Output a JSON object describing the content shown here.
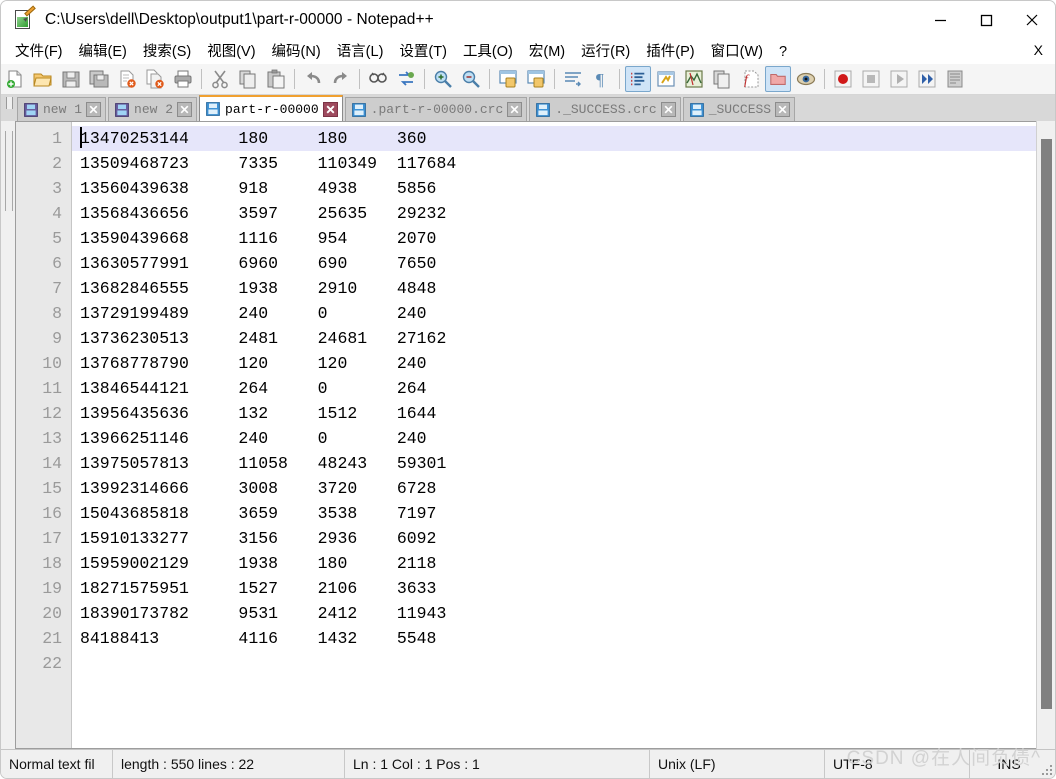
{
  "window": {
    "title": "C:\\Users\\dell\\Desktop\\output1\\part-r-00000 - Notepad++",
    "app_icon": "notepad-plus-plus-icon",
    "minimize_label": "—",
    "maximize_label": "□",
    "close_label": "✕"
  },
  "menu": {
    "items": [
      {
        "text": "文件(F)",
        "key": "F"
      },
      {
        "text": "编辑(E)",
        "key": "E"
      },
      {
        "text": "搜索(S)",
        "key": "S"
      },
      {
        "text": "视图(V)",
        "key": "V"
      },
      {
        "text": "编码(N)",
        "key": "N"
      },
      {
        "text": "语言(L)",
        "key": "L"
      },
      {
        "text": "设置(T)",
        "key": "T"
      },
      {
        "text": "工具(O)",
        "key": "O"
      },
      {
        "text": "宏(M)",
        "key": "M"
      },
      {
        "text": "运行(R)",
        "key": "R"
      },
      {
        "text": "插件(P)",
        "key": "P"
      },
      {
        "text": "窗口(W)",
        "key": "W"
      },
      {
        "text": "?",
        "key": ""
      }
    ],
    "close_document_label": "X"
  },
  "toolbar": {
    "buttons": [
      {
        "name": "new-file-icon",
        "active": false
      },
      {
        "name": "open-file-icon",
        "active": false
      },
      {
        "name": "save-icon",
        "active": false
      },
      {
        "name": "save-all-icon",
        "active": false
      },
      {
        "name": "close-file-icon",
        "active": false
      },
      {
        "name": "close-all-files-icon",
        "active": false
      },
      {
        "name": "print-icon",
        "active": false
      },
      {
        "name": "separator",
        "active": false
      },
      {
        "name": "cut-icon",
        "active": false
      },
      {
        "name": "copy-icon",
        "active": false
      },
      {
        "name": "paste-icon",
        "active": false
      },
      {
        "name": "separator",
        "active": false
      },
      {
        "name": "undo-icon",
        "active": false
      },
      {
        "name": "redo-icon",
        "active": false
      },
      {
        "name": "separator",
        "active": false
      },
      {
        "name": "find-icon",
        "active": false
      },
      {
        "name": "replace-icon",
        "active": false
      },
      {
        "name": "separator",
        "active": false
      },
      {
        "name": "zoom-in-icon",
        "active": false
      },
      {
        "name": "zoom-out-icon",
        "active": false
      },
      {
        "name": "separator",
        "active": false
      },
      {
        "name": "sync-vertical-scroll-icon",
        "active": false
      },
      {
        "name": "sync-horizontal-scroll-icon",
        "active": false
      },
      {
        "name": "separator",
        "active": false
      },
      {
        "name": "word-wrap-icon",
        "active": false
      },
      {
        "name": "show-all-characters-icon",
        "active": false
      },
      {
        "name": "separator",
        "active": false
      },
      {
        "name": "indent-guide-icon",
        "active": true
      },
      {
        "name": "user-defined-language-icon",
        "active": false
      },
      {
        "name": "document-map-icon",
        "active": false
      },
      {
        "name": "document-list-icon",
        "active": false
      },
      {
        "name": "function-list-icon",
        "active": false
      },
      {
        "name": "folder-as-workspace-icon",
        "active": true
      },
      {
        "name": "monitoring-icon",
        "active": false
      },
      {
        "name": "separator",
        "active": false
      },
      {
        "name": "record-macro-icon",
        "active": false
      },
      {
        "name": "stop-recording-icon",
        "active": false
      },
      {
        "name": "play-macro-icon",
        "active": false
      },
      {
        "name": "run-macro-multiple-icon",
        "active": false
      },
      {
        "name": "save-macro-icon",
        "active": false
      }
    ]
  },
  "tabs": [
    {
      "label": "new  1",
      "active": false,
      "icon": "saved-file-icon"
    },
    {
      "label": "new  2",
      "active": false,
      "icon": "saved-file-icon"
    },
    {
      "label": "part-r-00000",
      "active": true,
      "icon": "saved-file-icon"
    },
    {
      "label": ".part-r-00000.crc",
      "active": false,
      "icon": "saved-file-icon"
    },
    {
      "label": "._SUCCESS.crc",
      "active": false,
      "icon": "saved-file-icon"
    },
    {
      "label": "_SUCCESS",
      "active": false,
      "icon": "saved-file-icon"
    }
  ],
  "editor": {
    "current_line": 1,
    "line_numbers": [
      "1",
      "2",
      "3",
      "4",
      "5",
      "6",
      "7",
      "8",
      "9",
      "10",
      "11",
      "12",
      "13",
      "14",
      "15",
      "16",
      "17",
      "18",
      "19",
      "20",
      "21",
      "22"
    ],
    "lines": [
      "13470253144\t180\t180\t360",
      "13509468723\t7335\t110349\t117684",
      "13560439638\t918\t4938\t5856",
      "13568436656\t3597\t25635\t29232",
      "13590439668\t1116\t954\t2070",
      "13630577991\t6960\t690\t7650",
      "13682846555\t1938\t2910\t4848",
      "13729199489\t240\t0\t240",
      "13736230513\t2481\t24681\t27162",
      "13768778790\t120\t120\t240",
      "13846544121\t264\t0\t264",
      "13956435636\t132\t1512\t1644",
      "13966251146\t240\t0\t240",
      "13975057813\t11058\t48243\t59301",
      "13992314666\t3008\t3720\t6728",
      "15043685818\t3659\t3538\t7197",
      "15910133277\t3156\t2936\t6092",
      "15959002129\t1938\t180\t2118",
      "18271575951\t1527\t2106\t3633",
      "18390173782\t9531\t2412\t11943",
      "84188413\t4116\t1432\t5548",
      ""
    ]
  },
  "statusbar": {
    "doc_type": "Normal text fil",
    "length_lines": "length : 550    lines : 22",
    "caret_info": "Ln : 1    Col : 1    Pos : 1",
    "eol": "Unix (LF)",
    "encoding": "UTF-8",
    "insert_mode": "INS"
  },
  "watermark": {
    "text": "CSDN @在人间负债^"
  },
  "colors": {
    "accent_tab": "#f0a030",
    "current_line_highlight": "#e6e6fa",
    "gutter_bg": "#e8e8e8",
    "tabbar_bg": "#d8d8d8",
    "active_tab_close": "#9e4a5e"
  }
}
